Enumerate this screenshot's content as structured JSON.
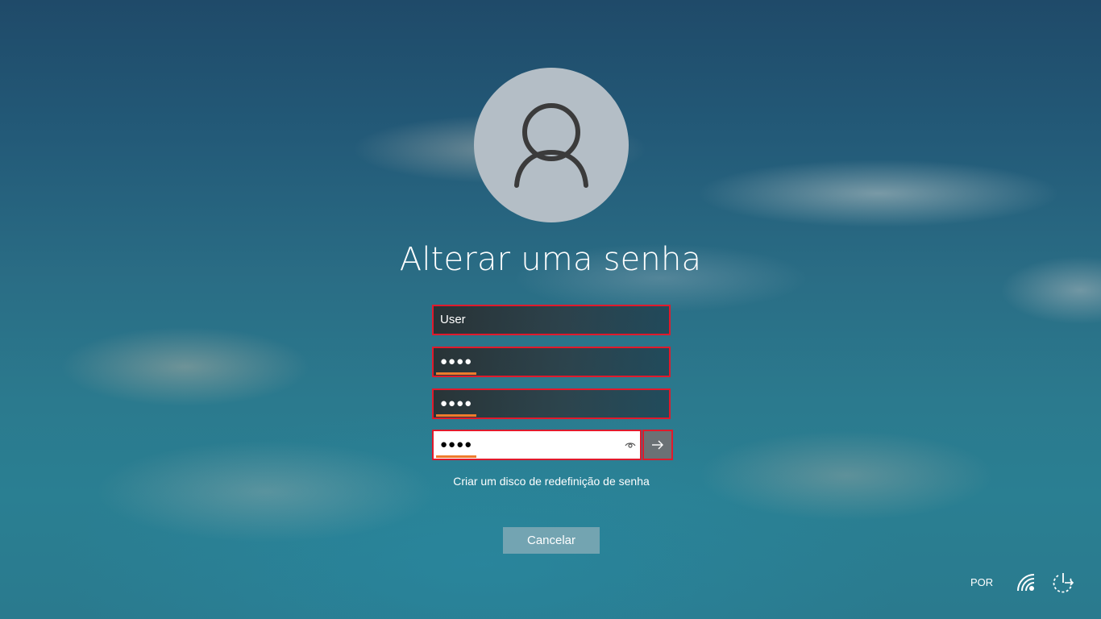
{
  "screen": {
    "title": "Alterar uma senha"
  },
  "form": {
    "username_value": "User",
    "old_password_value": "●●●●",
    "new_password_value": "●●●●",
    "confirm_password_value": "●●●●"
  },
  "links": {
    "reset_disk": "Criar um disco de redefinição de senha"
  },
  "buttons": {
    "cancel": "Cancelar"
  },
  "tray": {
    "language": "POR",
    "icons": [
      "wifi-icon",
      "power-options-icon"
    ]
  },
  "colors": {
    "highlight_border": "#e01a2c",
    "field_underline": "#ef7b2c",
    "avatar_bg": "#b4bec6"
  },
  "icons": {
    "avatar": "user-silhouette-icon",
    "reveal": "eye-icon",
    "submit": "arrow-right-icon"
  }
}
